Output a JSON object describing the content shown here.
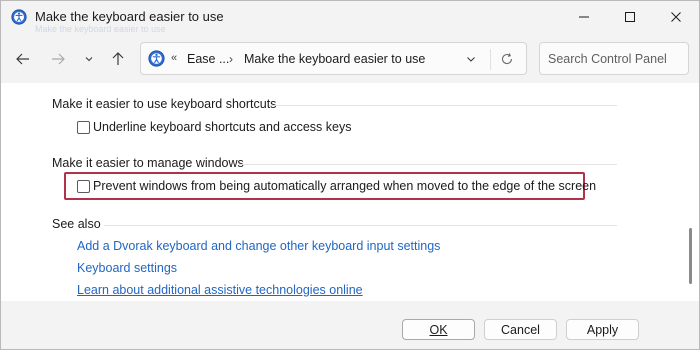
{
  "window": {
    "title": "Make the keyboard easier to use",
    "faded_text": "Make the keyboard easier to use",
    "minimize_icon": "minimize-icon",
    "maximize_icon": "maximize-icon",
    "close_icon": "close-icon"
  },
  "nav": {
    "back_icon": "back-arrow-icon",
    "forward_icon": "forward-arrow-icon",
    "recent_icon": "chevron-down-icon",
    "up_icon": "up-arrow-icon",
    "address": {
      "overflow": "«",
      "crumbs": [
        "Ease ...",
        "Make the keyboard easier to use"
      ],
      "separator": "›"
    },
    "search": {
      "placeholder": "Search Control Panel"
    }
  },
  "content": {
    "sections": [
      {
        "heading": "Make it easier to use keyboard shortcuts",
        "options": [
          {
            "label": "Underline keyboard shortcuts and access keys",
            "checked": false
          }
        ]
      },
      {
        "heading": "Make it easier to manage windows",
        "options": [
          {
            "label": "Prevent windows from being automatically arranged when moved to the edge of the screen",
            "checked": false,
            "highlighted": true
          }
        ]
      }
    ],
    "see_also": {
      "heading": "See also",
      "links": [
        "Add a Dvorak keyboard and change other keyboard input settings",
        "Keyboard settings",
        "Learn about additional assistive technologies online"
      ]
    }
  },
  "footer": {
    "ok": "OK",
    "cancel": "Cancel",
    "apply": "Apply"
  },
  "colors": {
    "highlight_border": "#b0314a",
    "link": "#2266c4",
    "window_bg": "#f3f3f3"
  }
}
